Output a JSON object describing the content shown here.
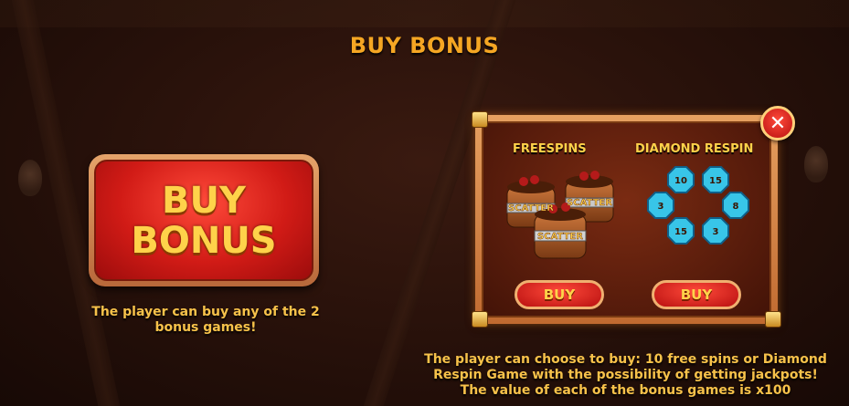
{
  "page": {
    "title": "BUY BONUS"
  },
  "buy_bonus_button": {
    "line1": "BUY",
    "line2": "BONUS"
  },
  "left_caption": {
    "line1": "The player can buy any of the 2",
    "line2": "bonus games!"
  },
  "panel": {
    "freespins": {
      "label": "FREESPINS",
      "barrel_text": "SCATTER",
      "buy_label": "BUY"
    },
    "diamond_respin": {
      "label": "DIAMOND RESPIN",
      "gem_values": [
        "10",
        "15",
        "3",
        "8",
        "15",
        "3"
      ],
      "buy_label": "BUY"
    },
    "close_symbol": "✕"
  },
  "bottom_caption": {
    "line1": "The player can choose to buy: 10 free spins or Diamond",
    "line2": "Respin Game with the possibility of getting jackpots!",
    "line3": "The value of each of the bonus games is x100"
  },
  "colors": {
    "accent": "#f5a623",
    "button_red": "#d11b16",
    "gem": "#38c5e8"
  }
}
